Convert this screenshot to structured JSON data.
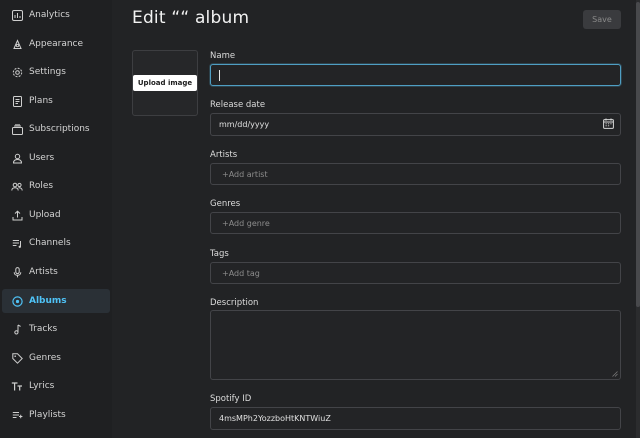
{
  "sidebar": {
    "items": [
      {
        "label": "Analytics",
        "icon": "analytics-icon"
      },
      {
        "label": "Appearance",
        "icon": "appearance-icon"
      },
      {
        "label": "Settings",
        "icon": "gear-icon"
      },
      {
        "label": "Plans",
        "icon": "plans-icon"
      },
      {
        "label": "Subscriptions",
        "icon": "subscriptions-icon"
      },
      {
        "label": "Users",
        "icon": "user-icon"
      },
      {
        "label": "Roles",
        "icon": "roles-icon"
      },
      {
        "label": "Upload",
        "icon": "upload-icon"
      },
      {
        "label": "Channels",
        "icon": "channels-icon"
      },
      {
        "label": "Artists",
        "icon": "microphone-icon"
      },
      {
        "label": "Albums",
        "icon": "album-icon",
        "active": true
      },
      {
        "label": "Tracks",
        "icon": "music-note-icon"
      },
      {
        "label": "Genres",
        "icon": "tag-icon"
      },
      {
        "label": "Lyrics",
        "icon": "text-icon"
      },
      {
        "label": "Playlists",
        "icon": "playlist-icon"
      }
    ]
  },
  "header": {
    "title": "Edit ““ album",
    "save_label": "Save"
  },
  "image": {
    "upload_label": "Upload image"
  },
  "form": {
    "name_label": "Name",
    "name_value": "",
    "release_date_label": "Release date",
    "release_date_placeholder": "mm/dd/yyyy",
    "artists_label": "Artists",
    "artists_placeholder": "+Add artist",
    "genres_label": "Genres",
    "genres_placeholder": "+Add genre",
    "tags_label": "Tags",
    "tags_placeholder": "+Add tag",
    "description_label": "Description",
    "spotify_label": "Spotify ID",
    "spotify_value": "4msMPh2YozzboHtKNTWiuZ"
  },
  "colors": {
    "background": "#222325",
    "accent": "#4fc3f7",
    "focus_border": "#4f9ec3"
  }
}
